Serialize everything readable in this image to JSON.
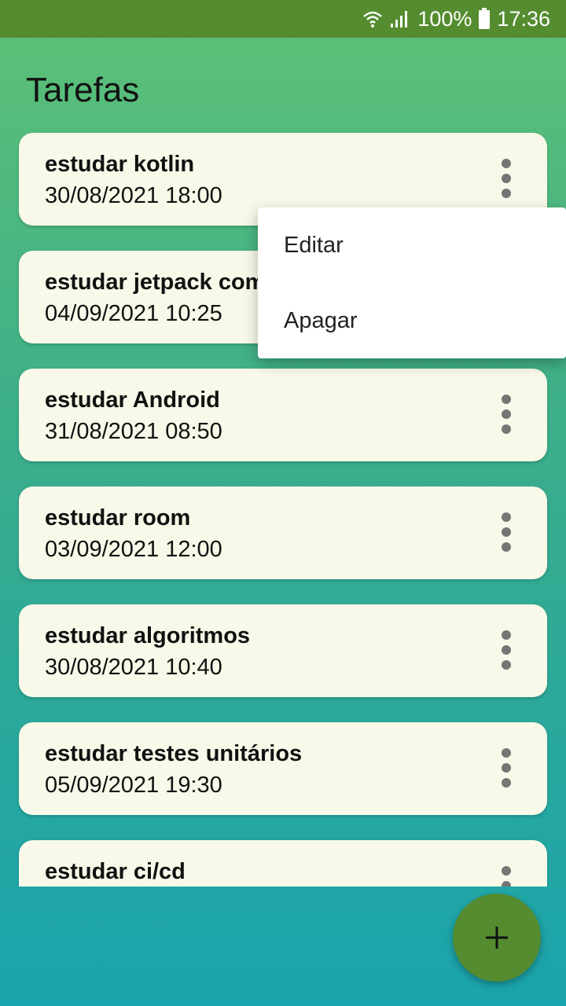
{
  "status_bar": {
    "wifi_icon": "wifi-icon",
    "signal_icon": "signal-icon",
    "battery_icon": "battery-icon",
    "battery_text": "100%",
    "time": "17:36"
  },
  "app": {
    "title": "Tarefas"
  },
  "tasks": [
    {
      "name": "estudar kotlin",
      "date": "30/08/2021 18:00"
    },
    {
      "name": "estudar jetpack compose",
      "date": "04/09/2021 10:25"
    },
    {
      "name": "estudar Android",
      "date": "31/08/2021 08:50"
    },
    {
      "name": "estudar room",
      "date": "03/09/2021 12:00"
    },
    {
      "name": "estudar algoritmos",
      "date": "30/08/2021 10:40"
    },
    {
      "name": "estudar testes unitários",
      "date": "05/09/2021 19:30"
    },
    {
      "name": "estudar ci/cd",
      "date": ""
    }
  ],
  "menu": {
    "edit": "Editar",
    "delete": "Apagar"
  },
  "fab": {
    "icon": "plus-icon"
  },
  "colors": {
    "status_bar": "#548c2f",
    "card": "#f8f9e8",
    "fab": "#548c2f",
    "gradient_top": "#5ec176",
    "gradient_bottom": "#1aa4ad"
  }
}
